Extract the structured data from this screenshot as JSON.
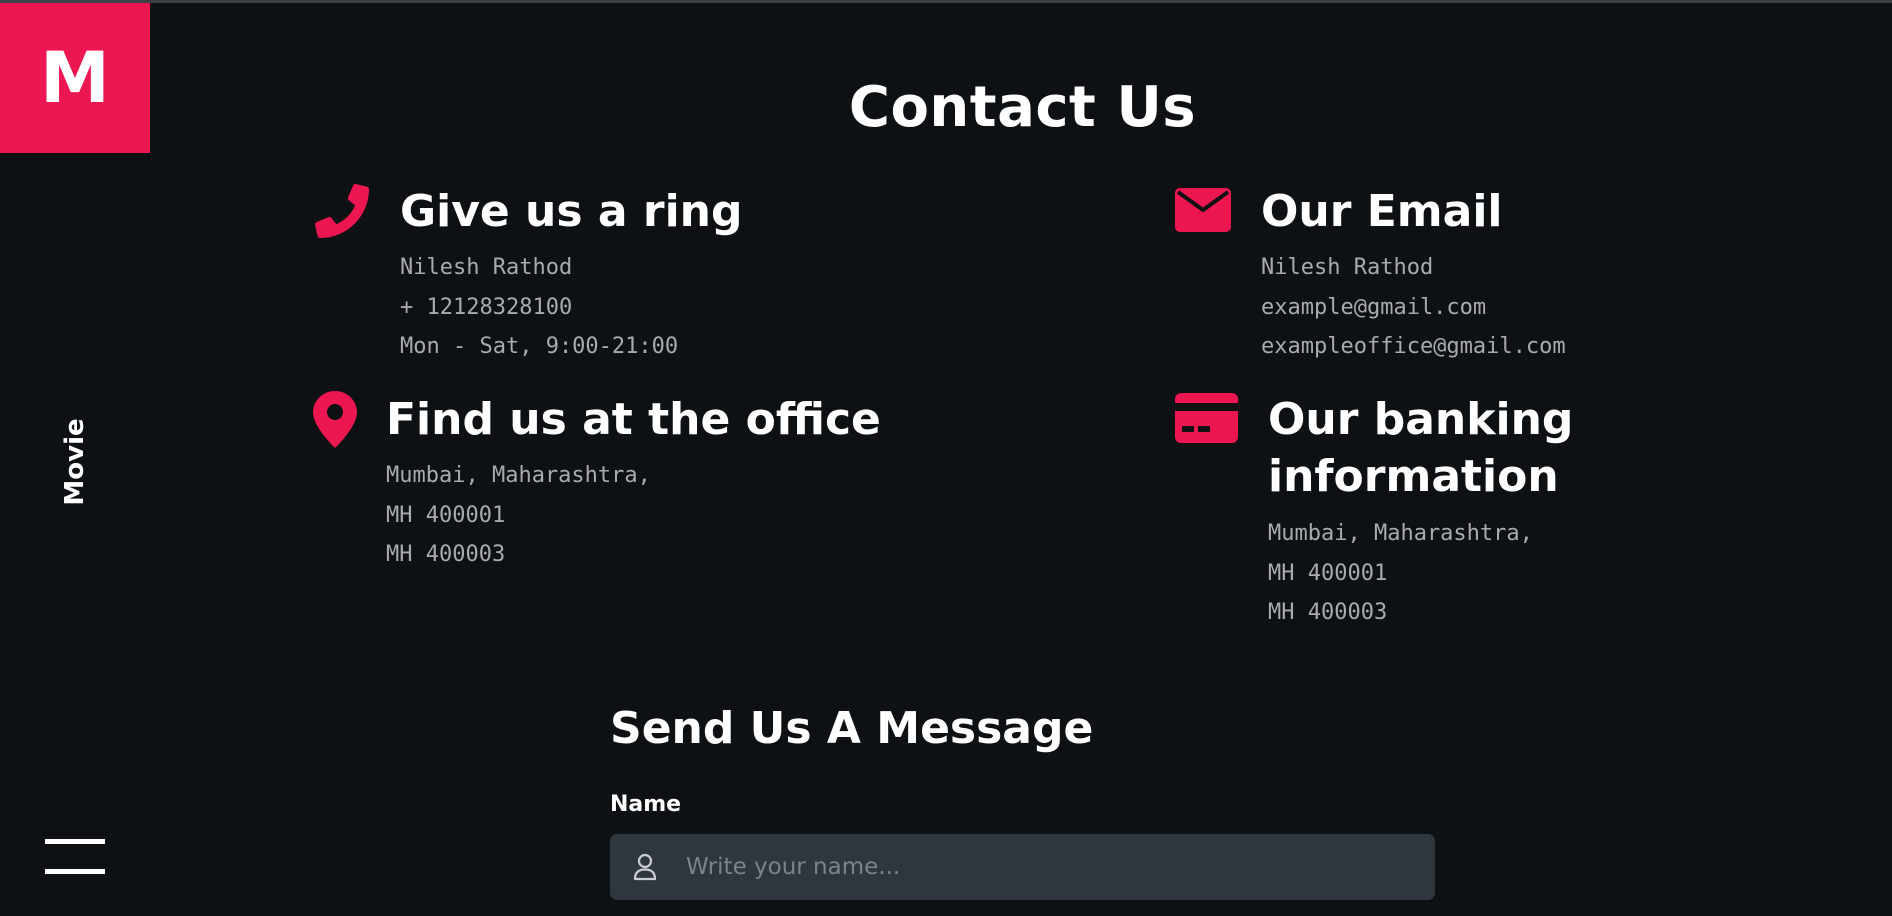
{
  "brand": {
    "logo_letter": "M",
    "side_label": "Movie",
    "accent_color": "#ec1651"
  },
  "page": {
    "title": "Contact Us"
  },
  "contact": {
    "phone": {
      "icon": "phone-icon",
      "title": "Give us a ring",
      "lines": [
        "Nilesh Rathod",
        "+ 12128328100",
        "Mon - Sat, 9:00-21:00"
      ]
    },
    "email": {
      "icon": "envelope-icon",
      "title": "Our Email",
      "lines": [
        "Nilesh Rathod",
        "example@gmail.com",
        "exampleoffice@gmail.com"
      ]
    },
    "office": {
      "icon": "map-pin-icon",
      "title": "Find us at the office",
      "lines": [
        "Mumbai, Maharashtra,",
        "MH 400001",
        "MH 400003"
      ]
    },
    "banking": {
      "icon": "credit-card-icon",
      "title_lines": [
        "Our banking",
        "information"
      ],
      "lines": [
        "Mumbai, Maharashtra,",
        "MH 400001",
        "MH 400003"
      ]
    }
  },
  "form": {
    "title": "Send Us A Message",
    "name_label": "Name",
    "name_placeholder": "Write your name...",
    "name_value": ""
  },
  "colors": {
    "background": "#0e1113",
    "muted_text": "#a8abae",
    "input_bg": "#30363e"
  }
}
